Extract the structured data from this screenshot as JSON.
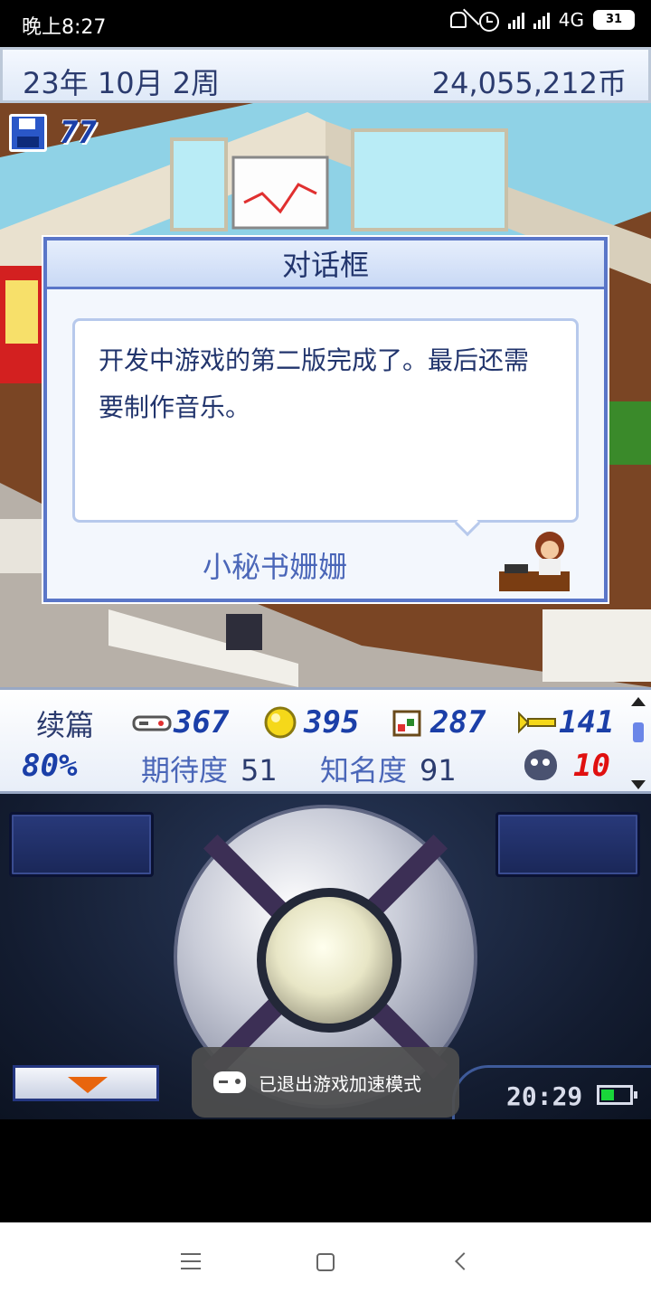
{
  "status_bar": {
    "time": "晚上8:27",
    "network": "4G",
    "battery": "31"
  },
  "header": {
    "date": "23年 10月 2周",
    "money": "24,055,212币"
  },
  "scene": {
    "save_count": "77"
  },
  "dialog": {
    "title": "对话框",
    "message": "开发中游戏的第二版完成了。最后还需要制作音乐。",
    "speaker": "小秘书姗姗"
  },
  "stats": {
    "genre": "续篇",
    "progress": "80%",
    "fun": "367",
    "creativity": "395",
    "graphics": "287",
    "sound": "141",
    "expectation_label": "期待度",
    "expectation_value": "51",
    "fame_label": "知名度",
    "fame_value": "91",
    "bugs": "10"
  },
  "controller": {
    "clock": "20:29"
  },
  "toast": {
    "text": "已退出游戏加速模式"
  },
  "colors": {
    "accent_blue": "#1b3fa8",
    "dialog_border": "#5a76c8",
    "bug_red": "#e01010"
  }
}
